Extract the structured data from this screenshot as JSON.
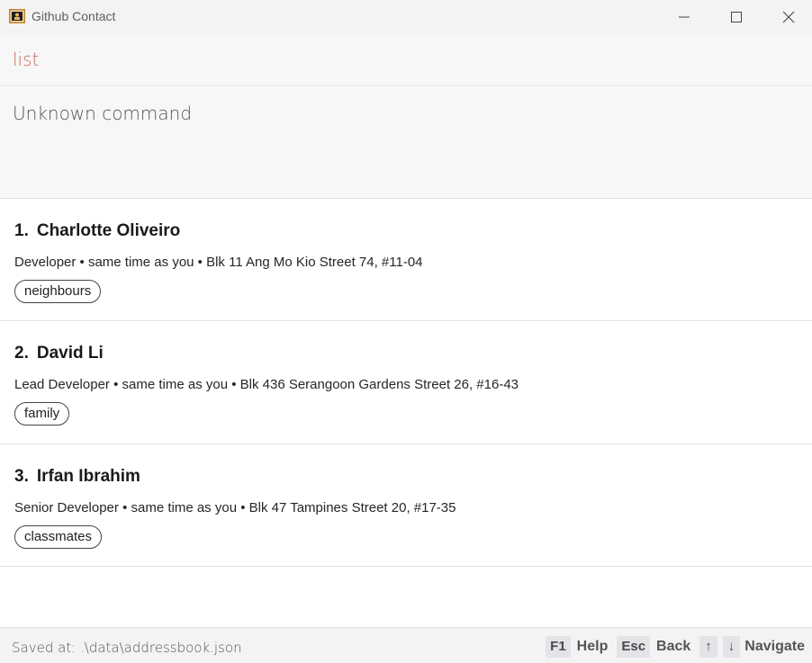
{
  "window": {
    "title": "Github Contact",
    "icons": {
      "app": "app-icon",
      "minimize": "minimize-icon",
      "maximize": "maximize-icon",
      "close": "close-icon"
    }
  },
  "command": {
    "value": "list",
    "color": "#c96a52"
  },
  "result": {
    "text": "Unknown command"
  },
  "persons": [
    {
      "index": "1.",
      "name": "Charlotte Oliveiro",
      "detail": "Developer • same time as you • Blk 11 Ang Mo Kio Street 74, #11-04",
      "tag": "neighbours"
    },
    {
      "index": "2.",
      "name": "David Li",
      "detail": "Lead Developer • same time as you • Blk 436 Serangoon Gardens Street 26, #16-43",
      "tag": "family"
    },
    {
      "index": "3.",
      "name": "Irfan Ibrahim",
      "detail": "Senior Developer • same time as you • Blk 47 Tampines Street 20, #17-35",
      "tag": "classmates"
    }
  ],
  "status": {
    "saved_path": "Saved at: .\\data\\addressbook.json",
    "shortcuts": {
      "help_key": "F1",
      "help_label": "Help",
      "back_key": "Esc",
      "back_label": "Back",
      "up_key": "↑",
      "down_key": "↓",
      "navigate_label": "Navigate"
    }
  }
}
